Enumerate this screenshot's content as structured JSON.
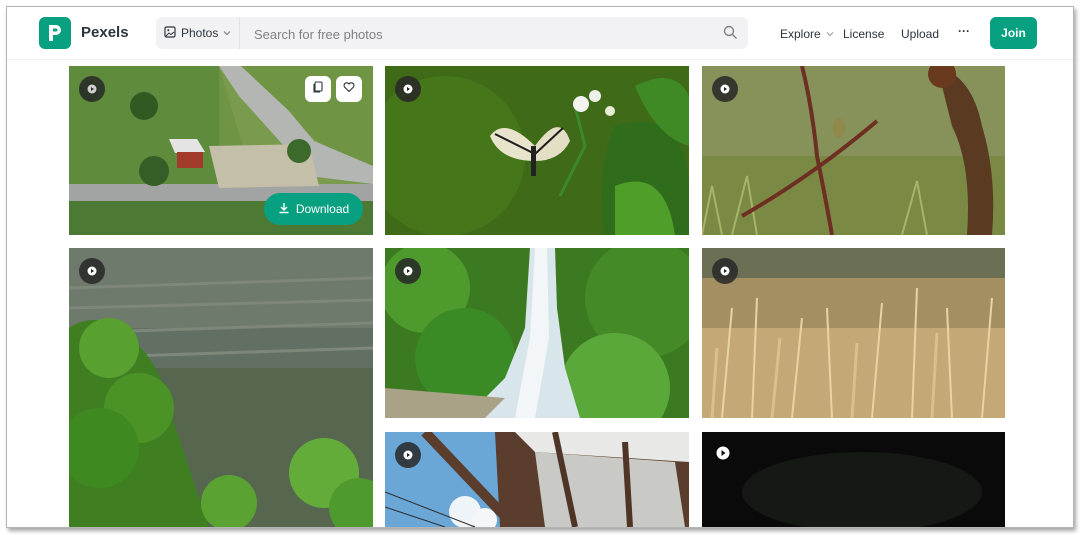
{
  "brand": {
    "name": "Pexels",
    "color": "#07a081"
  },
  "search": {
    "type_label": "Photos",
    "placeholder": "Search for free photos"
  },
  "nav": {
    "explore": "Explore",
    "license": "License",
    "upload": "Upload",
    "more": "···",
    "join": "Join"
  },
  "hover_tile": {
    "download_label": "Download"
  },
  "gallery": {
    "tiles": [
      {
        "subject": "aerial farmhouse road",
        "type": "video"
      },
      {
        "subject": "butterfly on white flowers",
        "type": "video"
      },
      {
        "subject": "bird on branch",
        "type": "video"
      },
      {
        "subject": "forest cliff",
        "type": "video"
      },
      {
        "subject": "waterfall",
        "type": "video"
      },
      {
        "subject": "dry grass field",
        "type": "video"
      },
      {
        "subject": "wooden roof and sky",
        "type": "video"
      },
      {
        "subject": "dark scene",
        "type": "video"
      }
    ]
  }
}
